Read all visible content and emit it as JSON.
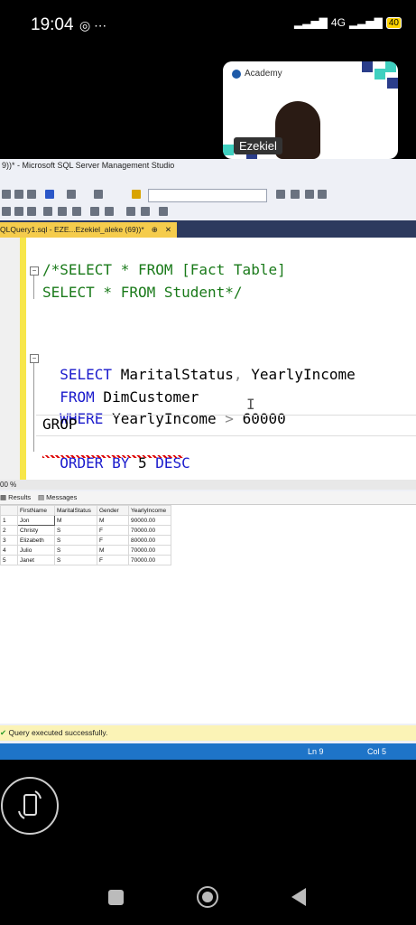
{
  "phone_status": {
    "time": "19:04",
    "network": "4G",
    "battery": "40"
  },
  "video": {
    "brand": "Academy",
    "speaker": "Ezekiel"
  },
  "window": {
    "title": "9))* - Microsoft SQL Server Management Studio"
  },
  "doc_tab": {
    "label": "QLQuery1.sql - EZE...Ezekiel_aleke (69))*",
    "pin": "⊕",
    "close": "✕"
  },
  "editor": {
    "lines": [
      {
        "text": "/*SELECT * FROM [Fact Table]"
      },
      {
        "text": "SELECT * FROM Student*/"
      },
      {
        "kw1": "SELECT",
        "rest1": " MaritalStatus",
        "sep": ",",
        "rest2": " YearlyIncome"
      },
      {
        "kw": "FROM",
        "rest": " DimCustomer"
      },
      {
        "kw": "WHERE",
        "rest": " YearlyIncome ",
        "op": ">",
        "val": " 60000"
      },
      {
        "text": "GROP"
      },
      {
        "kw": "ORDER BY",
        "rest": " 5 ",
        "kw2": "DESC"
      }
    ]
  },
  "zoom": "00 %",
  "results_tabs": {
    "results": "Results",
    "messages": "Messages"
  },
  "results": {
    "columns": [
      "FirstName",
      "MaritalStatus",
      "Gender",
      "YearlyIncome"
    ],
    "rows": [
      {
        "n": "1",
        "cells": [
          "Jon",
          "M",
          "M",
          "90000.00"
        ]
      },
      {
        "n": "2",
        "cells": [
          "Christy",
          "S",
          "F",
          "70000.00"
        ]
      },
      {
        "n": "3",
        "cells": [
          "Elizabeth",
          "S",
          "F",
          "80000.00"
        ]
      },
      {
        "n": "4",
        "cells": [
          "Julio",
          "S",
          "M",
          "70000.00"
        ]
      },
      {
        "n": "5",
        "cells": [
          "Janet",
          "S",
          "F",
          "70000.00"
        ]
      }
    ]
  },
  "status": {
    "message": "Query executed successfully.",
    "ln": "Ln 9",
    "col": "Col 5"
  },
  "colors": {
    "accent": "#1e74c8",
    "keyword": "#1a1acc",
    "comment": "#1a7a1a",
    "tab_active": "#f5cc4c"
  }
}
